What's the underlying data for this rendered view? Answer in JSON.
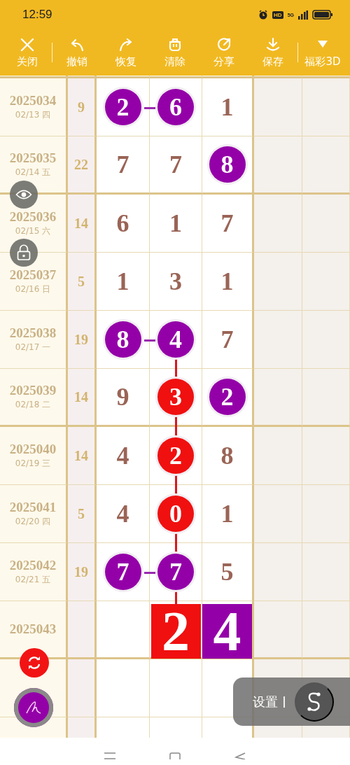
{
  "status_bar": {
    "time": "12:59",
    "hd": "HD",
    "network": "5G"
  },
  "toolbar": [
    {
      "label": "关闭"
    },
    {
      "label": "撤销"
    },
    {
      "label": "恢复"
    },
    {
      "label": "清除"
    },
    {
      "label": "分享"
    },
    {
      "label": "保存"
    },
    {
      "label": "福彩3D"
    }
  ],
  "rows": [
    {
      "issue": "2025034",
      "date": "02/13 四",
      "sum": "9",
      "cells": [
        {
          "kind": "ball",
          "value": "2",
          "color": "#9400a8",
          "link_next": true
        },
        {
          "kind": "ball",
          "value": "6",
          "color": "#9400a8"
        },
        {
          "kind": "plain",
          "value": "1"
        }
      ]
    },
    {
      "issue": "2025035",
      "date": "02/14 五",
      "sum": "22",
      "cells": [
        {
          "kind": "plain",
          "value": "7"
        },
        {
          "kind": "plain",
          "value": "7"
        },
        {
          "kind": "ball",
          "value": "8",
          "color": "#9400a8"
        }
      ]
    },
    {
      "issue": "2025036",
      "date": "02/15 六",
      "sum": "14",
      "cells": [
        {
          "kind": "plain",
          "value": "6"
        },
        {
          "kind": "plain",
          "value": "1"
        },
        {
          "kind": "plain",
          "value": "7"
        }
      ]
    },
    {
      "issue": "2025037",
      "date": "02/16 日",
      "sum": "5",
      "cells": [
        {
          "kind": "plain",
          "value": "1"
        },
        {
          "kind": "plain",
          "value": "3"
        },
        {
          "kind": "plain",
          "value": "1"
        }
      ]
    },
    {
      "issue": "2025038",
      "date": "02/17 一",
      "sum": "19",
      "cells": [
        {
          "kind": "ball",
          "value": "8",
          "color": "#9400a8",
          "link_next": true
        },
        {
          "kind": "ball",
          "value": "4",
          "color": "#9400a8"
        },
        {
          "kind": "plain",
          "value": "7"
        }
      ]
    },
    {
      "issue": "2025039",
      "date": "02/18 二",
      "sum": "14",
      "cells": [
        {
          "kind": "plain",
          "value": "9"
        },
        {
          "kind": "ball",
          "value": "3",
          "color": "#f01010",
          "link_up": true
        },
        {
          "kind": "ball",
          "value": "2",
          "color": "#9400a8"
        }
      ]
    },
    {
      "issue": "2025040",
      "date": "02/19 三",
      "sum": "14",
      "cells": [
        {
          "kind": "plain",
          "value": "4"
        },
        {
          "kind": "ball",
          "value": "2",
          "color": "#f01010",
          "link_up": true
        },
        {
          "kind": "plain",
          "value": "8"
        }
      ]
    },
    {
      "issue": "2025041",
      "date": "02/20 四",
      "sum": "5",
      "cells": [
        {
          "kind": "plain",
          "value": "4"
        },
        {
          "kind": "ball",
          "value": "0",
          "color": "#f01010",
          "link_up": true
        },
        {
          "kind": "plain",
          "value": "1"
        }
      ]
    },
    {
      "issue": "2025042",
      "date": "02/21 五",
      "sum": "19",
      "cells": [
        {
          "kind": "ball",
          "value": "7",
          "color": "#9400a8",
          "link_next": true
        },
        {
          "kind": "ball",
          "value": "7",
          "color": "#9400a8",
          "link_up": true
        },
        {
          "kind": "plain",
          "value": "5"
        }
      ]
    },
    {
      "issue": "2025043",
      "cells": [
        {
          "kind": "empty"
        },
        {
          "kind": "block",
          "value": "2",
          "color": "#f01010",
          "link_up": true
        },
        {
          "kind": "block",
          "value": "4",
          "color": "#9400a8"
        }
      ]
    }
  ],
  "settings_label": "设置"
}
